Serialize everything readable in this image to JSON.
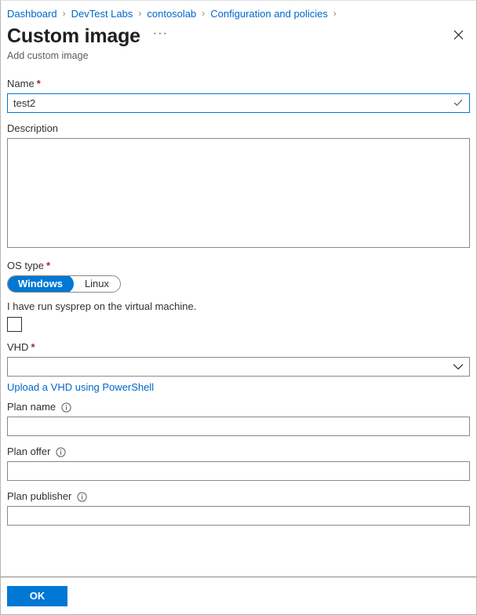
{
  "breadcrumb": {
    "separator": "›",
    "items": [
      {
        "label": "Dashboard"
      },
      {
        "label": "DevTest Labs"
      },
      {
        "label": "contosolab"
      },
      {
        "label": "Configuration and policies"
      }
    ]
  },
  "header": {
    "title": "Custom image",
    "more_label": "···",
    "subtitle": "Add custom image",
    "close_label": "×"
  },
  "form": {
    "name": {
      "label": "Name",
      "required_marker": "*",
      "value": "test2",
      "placeholder": "",
      "valid": true
    },
    "description": {
      "label": "Description",
      "value": "",
      "placeholder": ""
    },
    "os_type": {
      "label": "OS type",
      "required_marker": "*",
      "selected": "Windows",
      "options": [
        "Windows",
        "Linux"
      ]
    },
    "sysprep": {
      "label": "I have run sysprep on the virtual machine.",
      "checked": false
    },
    "vhd": {
      "label": "VHD",
      "required_marker": "*",
      "value": "",
      "placeholder": "",
      "link_label": "Upload a VHD using PowerShell"
    },
    "plan_name": {
      "label": "Plan name",
      "value": "",
      "placeholder": "",
      "info_icon": "info-icon"
    },
    "plan_offer": {
      "label": "Plan offer",
      "value": "",
      "placeholder": "",
      "info_icon": "info-icon"
    },
    "plan_publisher": {
      "label": "Plan publisher",
      "value": "",
      "placeholder": "",
      "info_icon": "info-icon"
    }
  },
  "footer": {
    "ok_label": "OK"
  },
  "colors": {
    "accent": "#0078d4",
    "link": "#0066cc",
    "required": "#a4262c",
    "border": "#8a8886",
    "text": "#323130",
    "subtle_text": "#605e5c"
  }
}
